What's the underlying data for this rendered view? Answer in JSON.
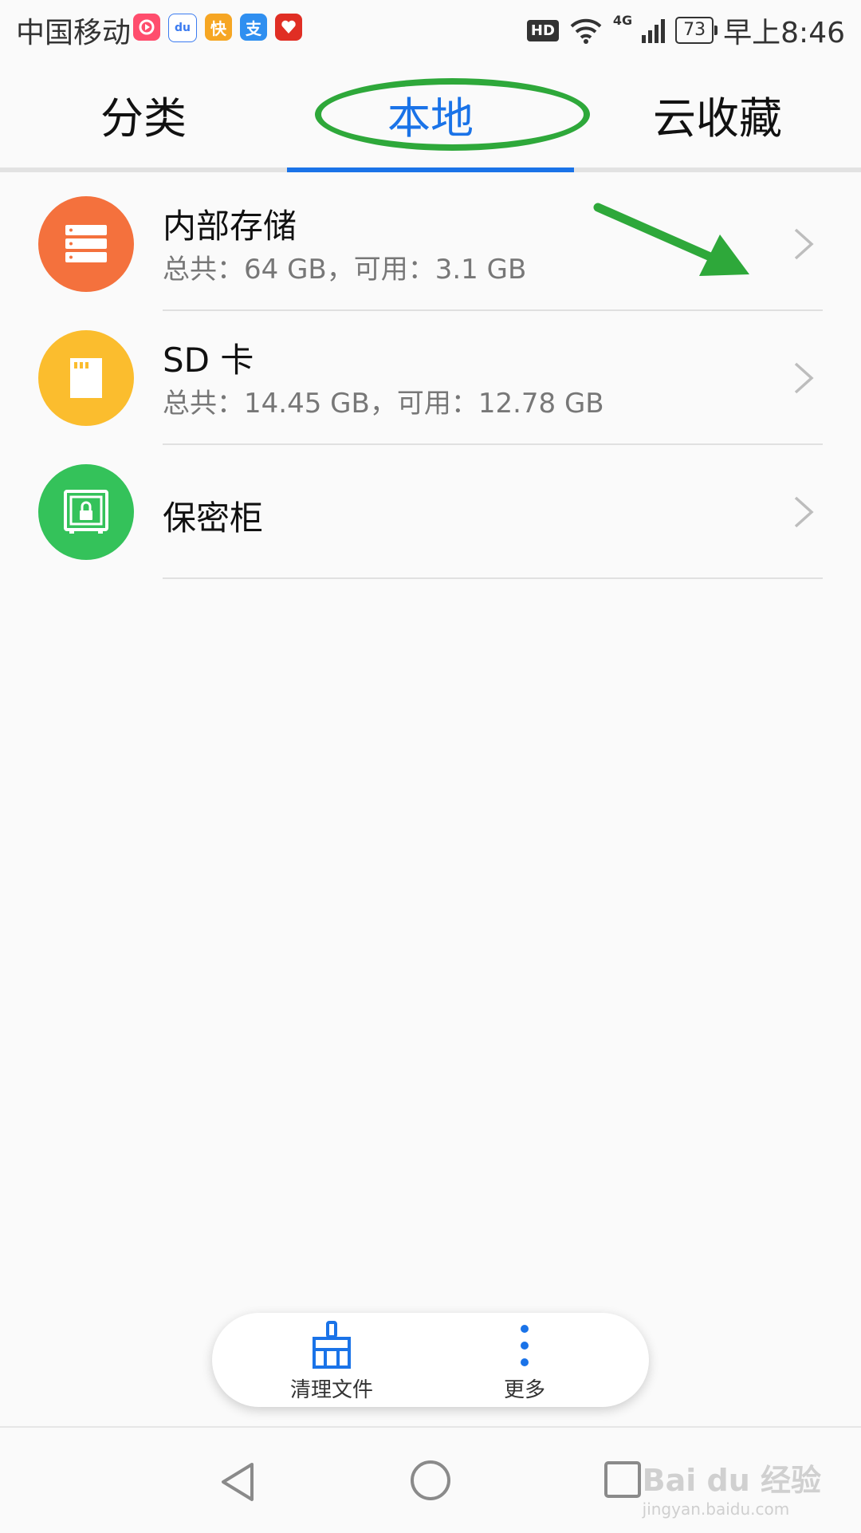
{
  "status_bar": {
    "carrier": "中国移动",
    "hd": "HD",
    "network": "4G",
    "battery": "73",
    "time": "早上8:46",
    "app_icons": [
      {
        "name": "video-app-icon",
        "color": "#ff4d6d",
        "glyph": ""
      },
      {
        "name": "baidu-app-icon",
        "color": "#3b7bf0",
        "glyph": "du"
      },
      {
        "name": "kuai-app-icon",
        "color": "#f6a623",
        "glyph": "快"
      },
      {
        "name": "alipay-app-icon",
        "color": "#2f8ff0",
        "glyph": "支"
      },
      {
        "name": "pinduoduo-app-icon",
        "color": "#e02e24",
        "glyph": ""
      }
    ]
  },
  "tabs": [
    {
      "label": "分类",
      "active": false
    },
    {
      "label": "本地",
      "active": true
    },
    {
      "label": "云收藏",
      "active": false
    }
  ],
  "storage_items": [
    {
      "title": "内部存储",
      "subtitle": "总共：64 GB，可用：3.1 GB",
      "icon": "storage-icon",
      "color": "#f4713d"
    },
    {
      "title": "SD 卡",
      "subtitle": "总共：14.45 GB，可用：12.78 GB",
      "icon": "sd-card-icon",
      "color": "#fbbd2e"
    },
    {
      "title": "保密柜",
      "subtitle": "",
      "icon": "safe-icon",
      "color": "#34c25a"
    }
  ],
  "bottom_actions": [
    {
      "label": "清理文件",
      "icon": "broom-icon"
    },
    {
      "label": "更多",
      "icon": "more-icon"
    }
  ],
  "watermark": {
    "brand": "Bai du 经验",
    "url": "jingyan.baidu.com"
  },
  "accent_color": "#1a73e8",
  "annotation_color": "#2ea83a"
}
